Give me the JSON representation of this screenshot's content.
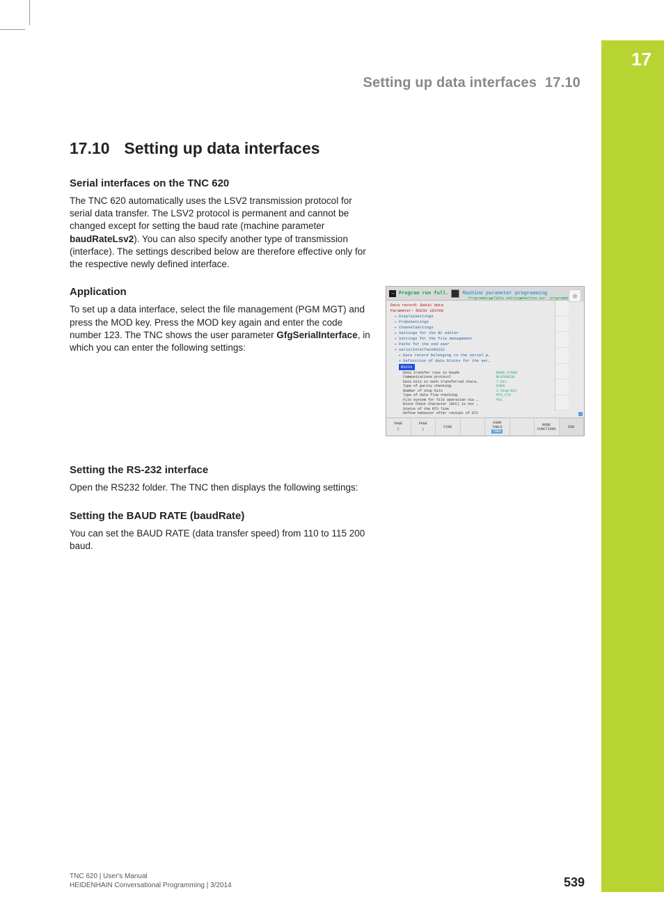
{
  "chapter_tab_number": "17",
  "running_header": {
    "title": "Setting up data interfaces",
    "number": "17.10"
  },
  "h1": {
    "number": "17.10",
    "title": "Setting up data interfaces"
  },
  "sec1": {
    "heading": "Serial interfaces on the TNC 620",
    "p_a": "The TNC 620 automatically uses the LSV2 transmission protocol for serial data transfer. The LSV2 protocol is permanent and cannot be changed except for setting the baud rate (machine parameter ",
    "p_bold1": "baudRateLsv2",
    "p_b": "). You can also specify another type of transmission (interface). The settings described below are therefore effective only for the respective newly defined interface."
  },
  "sec2": {
    "heading": "Application",
    "p_a": "To set up a data interface, select the file management (PGM MGT) and press the MOD key. Press the MOD key again and enter the code number 123. The TNC shows the user parameter ",
    "p_bold1": "GfgSerialInterface",
    "p_b": ", in which you can enter the following settings:"
  },
  "sec3": {
    "heading": "Setting the RS-232 interface",
    "p": "Open the RS232 folder. The TNC then displays the following settings:"
  },
  "sec4": {
    "heading": "Setting the BAUD RATE (baudRate)",
    "p": "You can set the BAUD RATE (data transfer speed) from 110 to 115 200 baud."
  },
  "screenshot": {
    "title_left": "Program run full.",
    "title_right": "Machine parameter programming",
    "subtitle": "Programming►Table editing►Machine par. programming",
    "line_data_record": "Data record: Basic data",
    "line_parameter": "Parameter: RS232 103700",
    "folders": [
      "DisplaySettings",
      "ProbeSettings",
      "ChannelSettings",
      "Settings for the NC editor",
      "Settings for the file management",
      "Paths for the end user",
      "serialInterfaceRS232"
    ],
    "folder_sub1": "Data record belonging to the serial p…",
    "folder_sub2": "Definition of data blocks for the ser…",
    "selected": "RS232",
    "params": [
      {
        "label": "Data transfer rate in bauds",
        "val": "BAUD_57600"
      },
      {
        "label": "Communications protocol",
        "val": "BLOCKWISE"
      },
      {
        "label": "Data bits in each transferred chara…",
        "val": "7 bit"
      },
      {
        "label": "Type of parity checking",
        "val": "EVEN"
      },
      {
        "label": "Number of stop bits",
        "val": "1 Stop-Bit"
      },
      {
        "label": "Type of data flow checking",
        "val": "RTS_CTS"
      },
      {
        "label": "File system for file operation via …",
        "val": "FE1"
      },
      {
        "label": "Block Check Character (BCC) is not …",
        "val": ""
      },
      {
        "label": "Status of the RTS line",
        "val": ""
      },
      {
        "label": "Define behavior after receipt of ETX",
        "val": ""
      }
    ],
    "softkeys": {
      "k1": "PAGE",
      "k2": "PAGE",
      "k3": "FIND",
      "k5a": "FORM",
      "k5b": "TABLE",
      "k5c": "TREE",
      "k7": "MORE FUNCTIONS",
      "k8": "END"
    }
  },
  "footer": {
    "line1": "TNC 620 | User's Manual",
    "line2": "HEIDENHAIN Conversational Programming | 3/2014",
    "page": "539"
  }
}
